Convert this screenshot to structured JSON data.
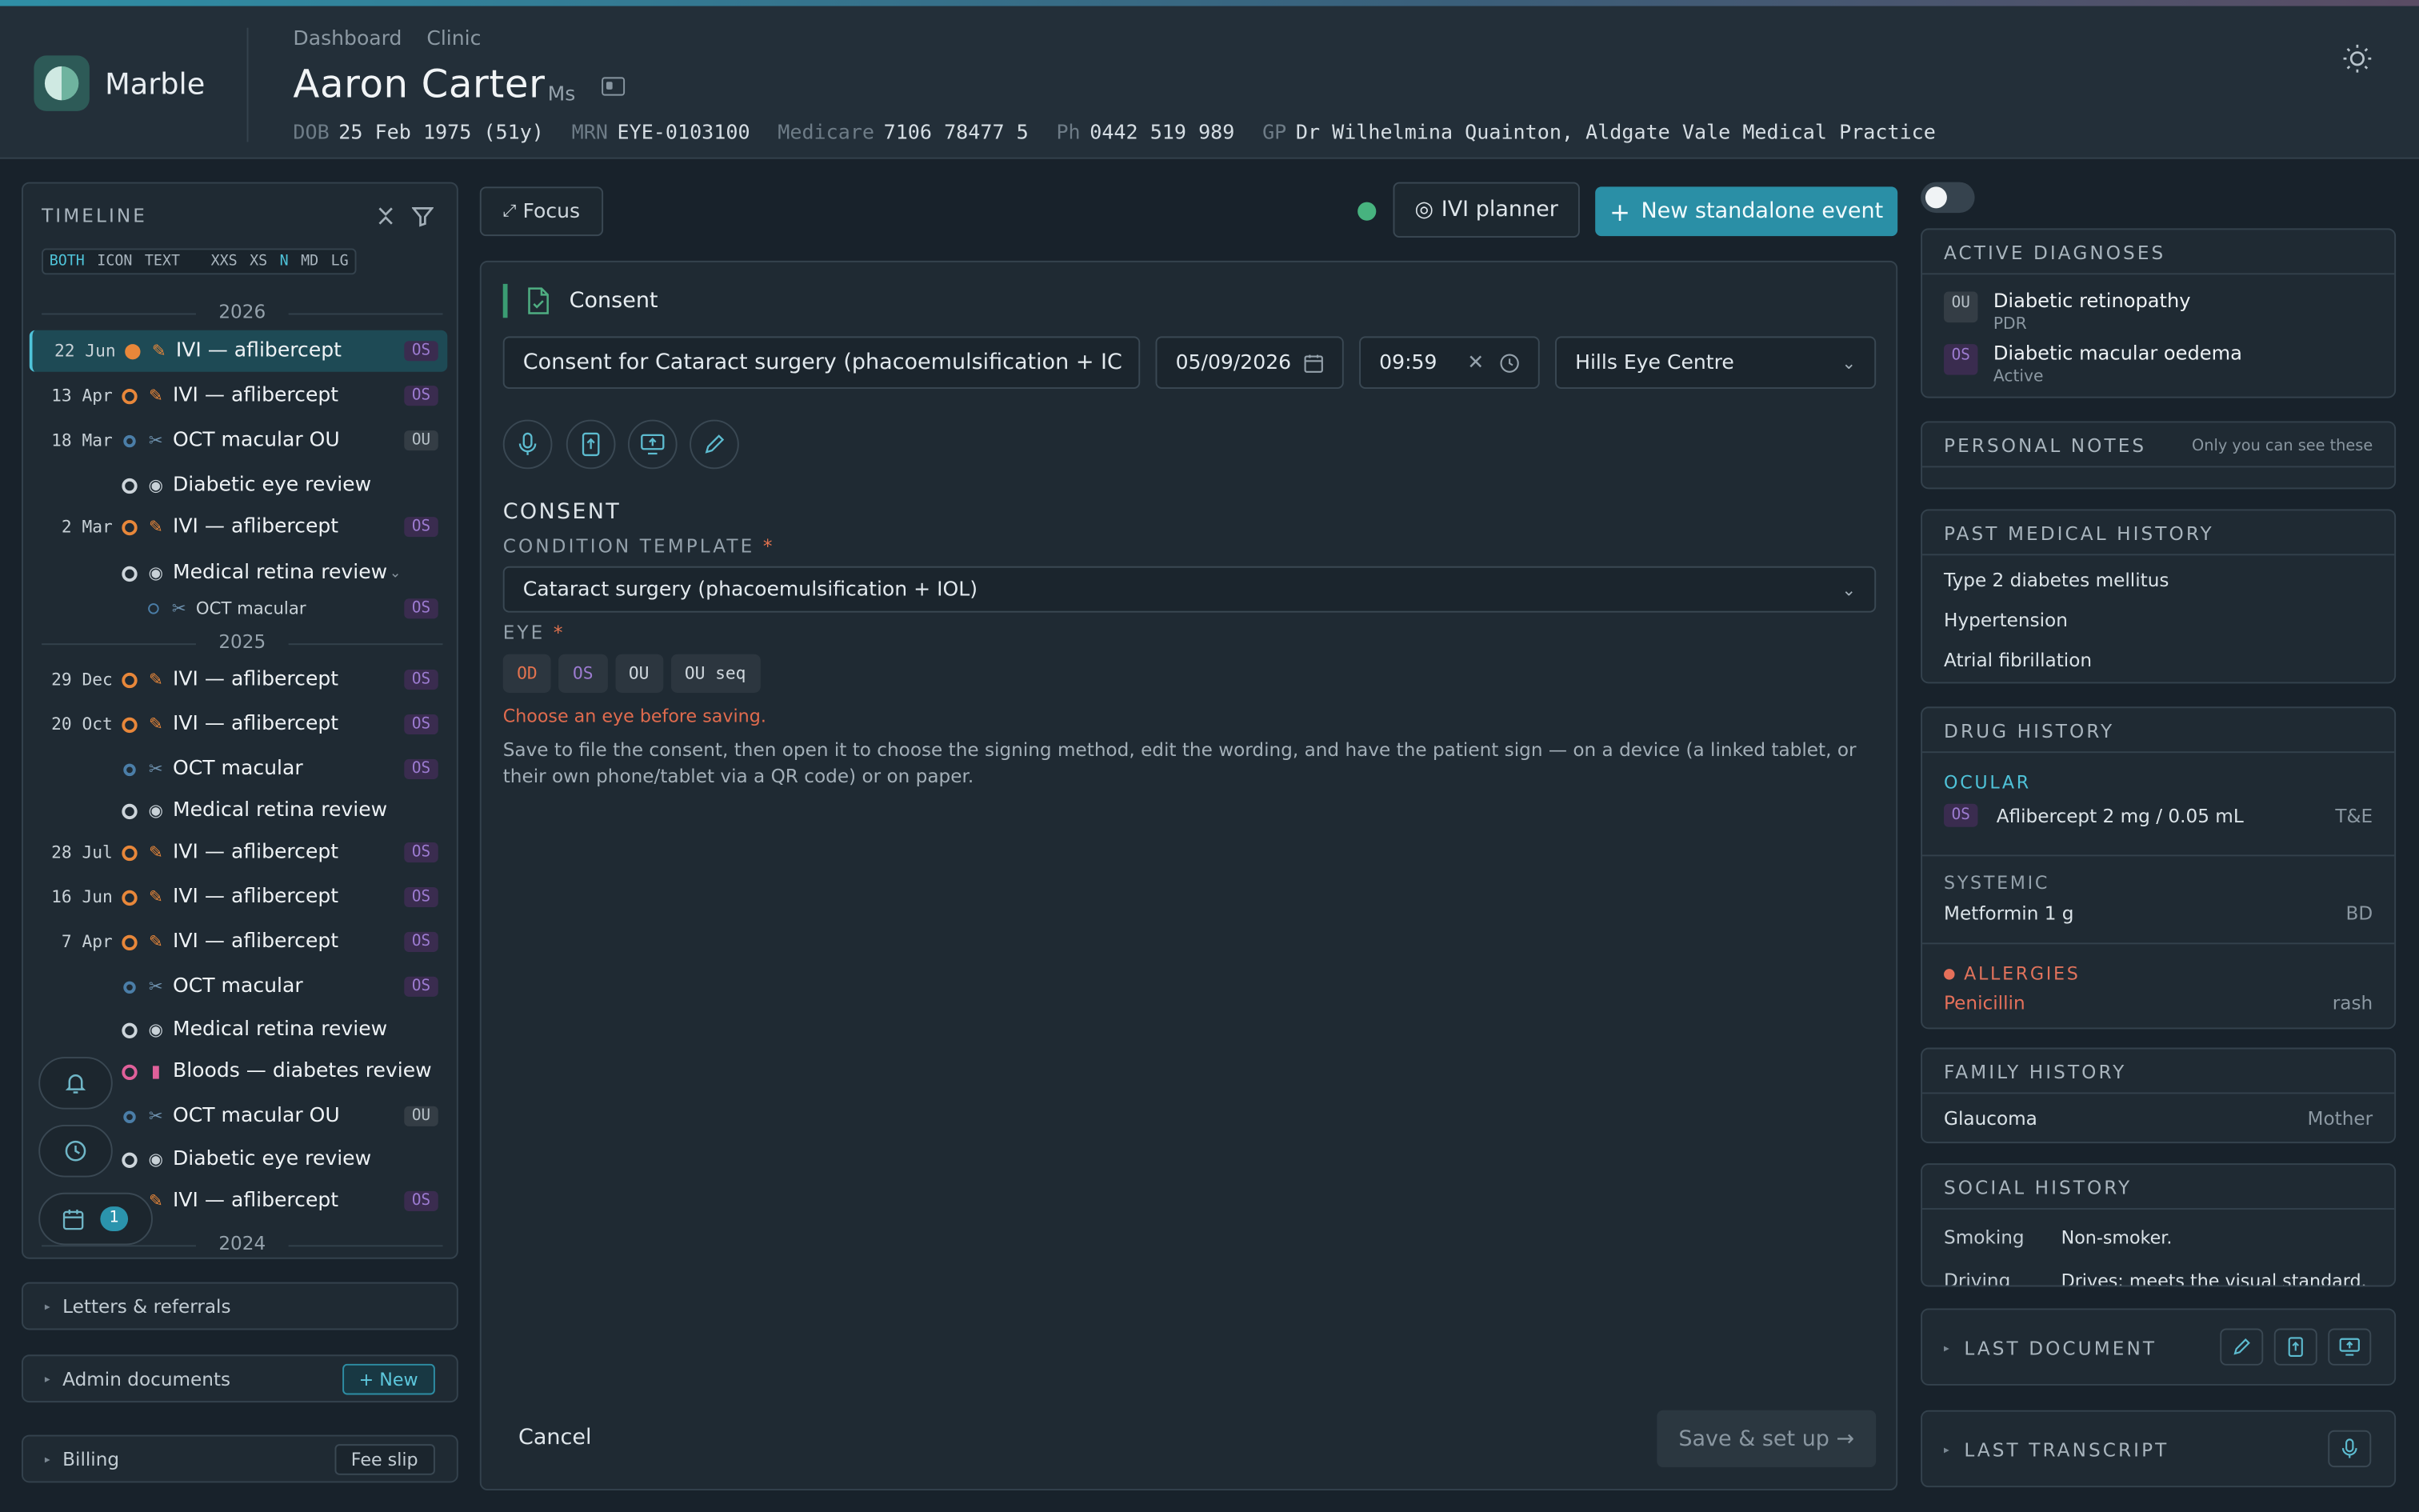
{
  "app": {
    "brand": "Marble"
  },
  "breadcrumbs": [
    "Dashboard",
    "Clinic"
  ],
  "patient": {
    "name": "Aaron Carter",
    "title": "Ms",
    "dob_label": "DOB",
    "dob": "25 Feb 1975 (51y)",
    "mrn_label": "MRN",
    "mrn": "EYE-0103100",
    "medicare_label": "Medicare",
    "medicare": "7106 78477 5",
    "ph_label": "Ph",
    "ph": "0442 519 989",
    "gp_label": "GP",
    "gp": "Dr Wilhelmina Quainton, Aldgate Vale Medical Practice"
  },
  "timeline": {
    "title": "TIMELINE",
    "modes": [
      "BOTH",
      "ICON",
      "TEXT"
    ],
    "sizes": [
      "XXS",
      "XS",
      "N",
      "MD",
      "LG"
    ],
    "years": [
      "2026",
      "2025",
      "2024"
    ],
    "events": [
      {
        "date": "22 Jun",
        "name": "IVI — aflibercept",
        "eye": "OS"
      },
      {
        "date": "13 Apr",
        "name": "IVI — aflibercept",
        "eye": "OS"
      },
      {
        "date": "18 Mar",
        "name": "OCT macular OU",
        "eye": "OU"
      },
      {
        "date": "",
        "name": "Diabetic eye review",
        "eye": ""
      },
      {
        "date": "2 Mar",
        "name": "IVI — aflibercept",
        "eye": "OS"
      },
      {
        "date": "",
        "name": "Medical retina review",
        "eye": ""
      },
      {
        "date": "",
        "name": "OCT macular",
        "eye": "OS"
      },
      {
        "date": "29 Dec",
        "name": "IVI — aflibercept",
        "eye": "OS"
      },
      {
        "date": "20 Oct",
        "name": "IVI — aflibercept",
        "eye": "OS"
      },
      {
        "date": "",
        "name": "OCT macular",
        "eye": "OS"
      },
      {
        "date": "",
        "name": "Medical retina review",
        "eye": ""
      },
      {
        "date": "28 Jul",
        "name": "IVI — aflibercept",
        "eye": "OS"
      },
      {
        "date": "16 Jun",
        "name": "IVI — aflibercept",
        "eye": "OS"
      },
      {
        "date": "7 Apr",
        "name": "IVI — aflibercept",
        "eye": "OS"
      },
      {
        "date": "",
        "name": "OCT macular",
        "eye": "OS"
      },
      {
        "date": "",
        "name": "Medical retina review",
        "eye": ""
      },
      {
        "date": "",
        "name": "Bloods — diabetes review",
        "eye": ""
      },
      {
        "date": "",
        "name": "OCT macular OU",
        "eye": "OU"
      },
      {
        "date": "",
        "name": "Diabetic eye review",
        "eye": ""
      },
      {
        "date": "",
        "name": "IVI — aflibercept",
        "eye": "OS"
      }
    ],
    "reminder_count": "1"
  },
  "sections": {
    "letters": "Letters & referrals",
    "admin": "Admin documents",
    "admin_btn": "+ New",
    "billing": "Billing",
    "billing_btn": "Fee slip"
  },
  "toolbar": {
    "focus": "Focus",
    "planner": "IVI planner",
    "new_event": "New standalone event"
  },
  "form": {
    "header": "Consent",
    "title_value": "Consent for Cataract surgery (phacoemulsification + IC",
    "date_value": "05/09/2026",
    "time_value": "09:59",
    "location_value": "Hills Eye Centre",
    "section": "CONSENT",
    "template_label": "CONDITION TEMPLATE",
    "template_value": "Cataract surgery (phacoemulsification + IOL)",
    "eye_label": "EYE",
    "eye_options": [
      "OD",
      "OS",
      "OU",
      "OU seq"
    ],
    "error": "Choose an eye before saving.",
    "help": "Save to file the consent, then open it to choose the signing method, edit the wording, and have the patient sign — on a device (a linked tablet, or their own phone/tablet via a QR code) or on paper.",
    "cancel": "Cancel",
    "save": "Save & set up →",
    "required_mark": "*"
  },
  "right": {
    "diagnoses_title": "ACTIVE DIAGNOSES",
    "diagnoses": [
      {
        "eye": "OU",
        "name": "Diabetic retinopathy",
        "sub": "PDR"
      },
      {
        "eye": "OS",
        "name": "Diabetic macular oedema",
        "sub": "Active"
      }
    ],
    "notes_title": "PERSONAL NOTES",
    "notes_sub": "Only you can see these",
    "pmh_title": "PAST MEDICAL HISTORY",
    "pmh": [
      "Type 2 diabetes mellitus",
      "Hypertension",
      "Atrial fibrillation"
    ],
    "drug_title": "DRUG HISTORY",
    "ocular_label": "OCULAR",
    "ocular": {
      "eye": "OS",
      "name": "Aflibercept 2 mg / 0.05 mL",
      "freq": "T&E"
    },
    "systemic_label": "SYSTEMIC",
    "systemic": {
      "name": "Metformin 1 g",
      "freq": "BD"
    },
    "allergies_label": "ALLERGIES",
    "allergy": {
      "name": "Penicillin",
      "reaction": "rash"
    },
    "family_title": "FAMILY HISTORY",
    "family": {
      "name": "Glaucoma",
      "who": "Mother"
    },
    "social_title": "SOCIAL HISTORY",
    "social": [
      {
        "k": "Smoking",
        "v": "Non-smoker."
      },
      {
        "k": "Driving",
        "v": "Drives; meets the visual standard."
      }
    ],
    "last_document": "LAST DOCUMENT",
    "last_transcript": "LAST TRANSCRIPT"
  },
  "colors": {
    "accent": "#2a8fa6",
    "ivi": "#e8873a",
    "os": "#9c7bd0",
    "od": "#e3734f",
    "error": "#e06b4e"
  }
}
